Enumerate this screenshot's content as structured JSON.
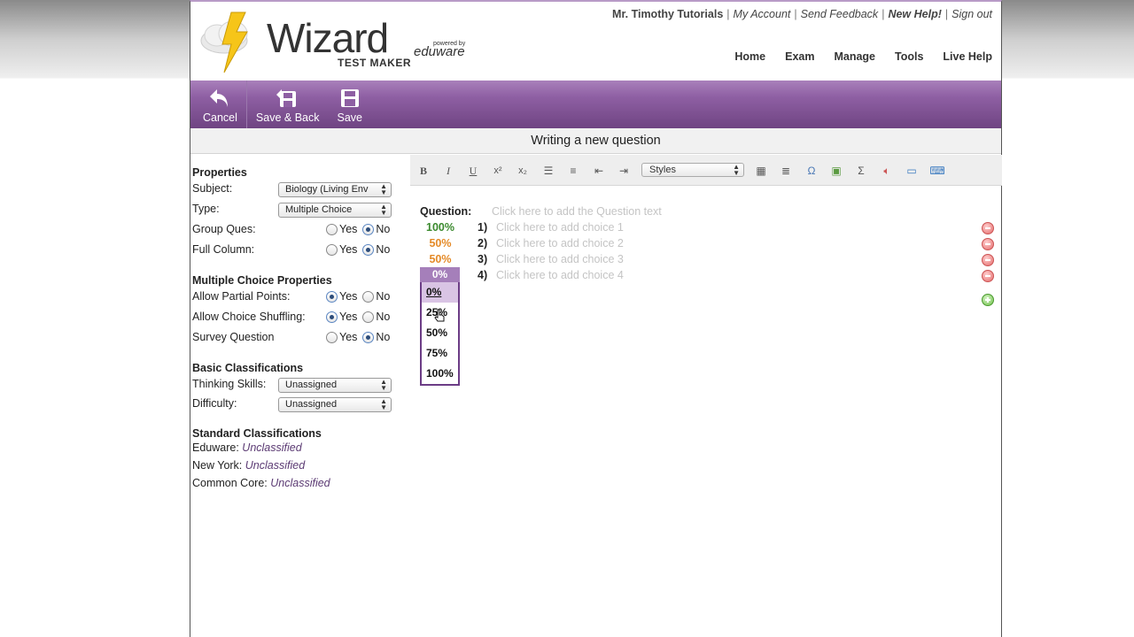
{
  "header": {
    "logo_text": "Wizard",
    "logo_sub": "TEST MAKER",
    "powered_by": "powered by",
    "brand": "eduware",
    "user_name": "Mr. Timothy Tutorials",
    "links": {
      "my_account": "My Account",
      "send_feedback": "Send Feedback",
      "new_help": "New Help!",
      "sign_out": "Sign out"
    },
    "nav": [
      "Home",
      "Exam",
      "Manage",
      "Tools",
      "Live Help"
    ]
  },
  "actionbar": {
    "cancel": "Cancel",
    "save_back": "Save & Back",
    "save": "Save"
  },
  "page_title": "Writing a new question",
  "properties": {
    "title": "Properties",
    "subject_label": "Subject:",
    "subject_value": "Biology (Living Env",
    "type_label": "Type:",
    "type_value": "Multiple Choice",
    "group_label": "Group Ques:",
    "group_selected": "No",
    "full_column_label": "Full Column:",
    "full_column_selected": "No",
    "yes": "Yes",
    "no": "No"
  },
  "mc_properties": {
    "title": "Multiple Choice Properties",
    "partial_label": "Allow Partial Points:",
    "partial_selected": "Yes",
    "shuffle_label": "Allow Choice Shuffling:",
    "shuffle_selected": "Yes",
    "survey_label": "Survey Question",
    "survey_selected": "No"
  },
  "basic": {
    "title": "Basic Classifications",
    "thinking_label": "Thinking Skills:",
    "thinking_value": "Unassigned",
    "difficulty_label": "Difficulty:",
    "difficulty_value": "Unassigned"
  },
  "standard": {
    "title": "Standard Classifications",
    "items": [
      {
        "label": "Eduware:",
        "value": "Unclassified"
      },
      {
        "label": "New York:",
        "value": "Unclassified"
      },
      {
        "label": "Common Core:",
        "value": "Unclassified"
      }
    ]
  },
  "editor_toolbar": {
    "bold": "B",
    "italic": "I",
    "underline": "U",
    "styles": "Styles"
  },
  "question": {
    "label": "Question:",
    "placeholder": "Click here to add the Question text",
    "choices": [
      {
        "pct": "100%",
        "num": "1)",
        "placeholder": "Click here to add choice 1"
      },
      {
        "pct": "50%",
        "num": "2)",
        "placeholder": "Click here to add choice 2"
      },
      {
        "pct": "50%",
        "num": "3)",
        "placeholder": "Click here to add choice 3"
      },
      {
        "pct": "0%",
        "num": "4)",
        "placeholder": "Click here to add choice 4"
      }
    ],
    "dropdown_options": [
      "0%",
      "25%",
      "50%",
      "75%",
      "100%"
    ]
  },
  "colors": {
    "accent_purple": "#8e5fa3",
    "correct_green": "#3b8a2e",
    "partial_orange": "#e48a28",
    "classification_text": "#5b3a73"
  }
}
